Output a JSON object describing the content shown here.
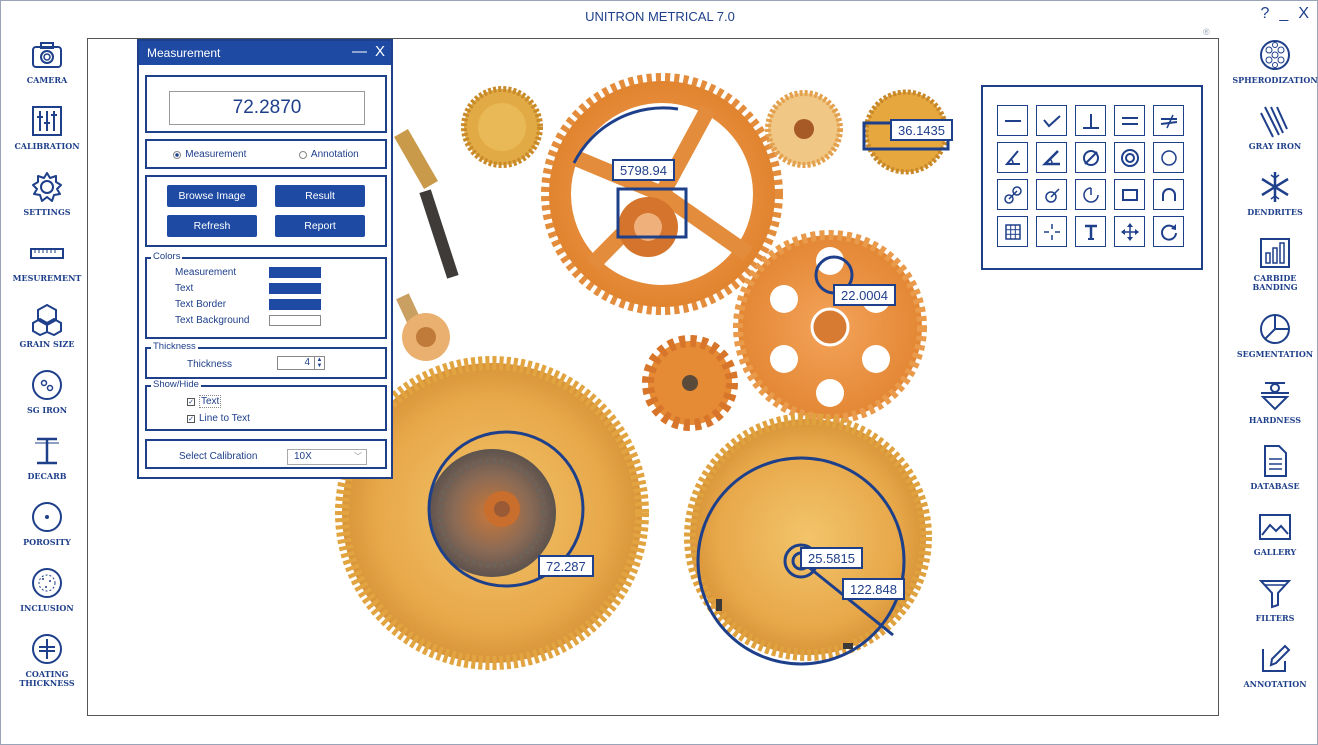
{
  "app": {
    "title": "UNITRON METRICAL 7.0",
    "help": "?",
    "minimize": "_",
    "close": "X",
    "info": "®"
  },
  "left_tools": [
    {
      "label": "CAMERA",
      "icon": "camera-icon"
    },
    {
      "label": "CALIBRATION",
      "icon": "sliders-icon"
    },
    {
      "label": "SETTINGS",
      "icon": "gear-icon"
    },
    {
      "label": "MESUREMENT",
      "icon": "ruler-icon"
    },
    {
      "label": "GRAIN SIZE",
      "icon": "grain-icon"
    },
    {
      "label": "SG IRON",
      "icon": "sg-iron-icon"
    },
    {
      "label": "DECARB",
      "icon": "decarb-icon"
    },
    {
      "label": "POROSITY",
      "icon": "porosity-icon"
    },
    {
      "label": "INCLUSION",
      "icon": "inclusion-icon"
    },
    {
      "label": "COATING",
      "label2": "THICKNESS",
      "icon": "coating-icon"
    }
  ],
  "right_tools": [
    {
      "label": "SPHERODIZATION",
      "icon": "spherodization-icon"
    },
    {
      "label": "GRAY IRON",
      "icon": "gray-iron-icon"
    },
    {
      "label": "DENDRITES",
      "icon": "snowflake-icon"
    },
    {
      "label": "CARBIDE",
      "label2": "BANDING",
      "icon": "bar-chart-icon"
    },
    {
      "label": "SEGMENTATION",
      "icon": "pie-chart-icon"
    },
    {
      "label": "HARDNESS",
      "icon": "hardness-icon"
    },
    {
      "label": "DATABASE",
      "icon": "document-icon"
    },
    {
      "label": "GALLERY",
      "icon": "gallery-icon"
    },
    {
      "label": "FILTERS",
      "icon": "funnel-icon"
    },
    {
      "label": "ANNOTATION",
      "icon": "pencil-icon"
    }
  ],
  "panel": {
    "title": "Measurement",
    "minimize": "—",
    "close": "X",
    "readout": "72.2870",
    "mode_measurement": "Measurement",
    "mode_annotation": "Annotation",
    "browse": "Browse Image",
    "result": "Result",
    "refresh": "Refresh",
    "report": "Report",
    "colors_legend": "Colors",
    "color_measurement": "Measurement",
    "color_text": "Text",
    "color_text_border": "Text Border",
    "color_text_background": "Text Background",
    "colors": {
      "measurement": "#1e4aa3",
      "text": "#1e4aa3",
      "text_border": "#1e4aa3",
      "text_background": "#ffffff"
    },
    "thickness_legend": "Thickness",
    "thickness_label": "Thickness",
    "thickness_value": "4",
    "showhide_legend": "Show/Hide",
    "show_text": "Text",
    "show_line": "Line to Text",
    "calib_label": "Select Calibration",
    "calib_value": "10X"
  },
  "measurements": {
    "m1": "5798.94",
    "m2": "36.1435",
    "m3": "22.0004",
    "m4": "72.287",
    "m5": "25.5815",
    "m6": "122.848"
  },
  "palette": [
    "line-icon",
    "polyline-icon",
    "perpendicular-icon",
    "parallel-icon",
    "not-parallel-icon",
    "angle-icon",
    "angle-three-point-icon",
    "diameter-icon",
    "concentric-circle-icon",
    "circle-icon",
    "circle-distance-icon",
    "circle-point-icon",
    "arc-icon",
    "rectangle-icon",
    "curve-icon",
    "grid-icon",
    "crosshair-icon",
    "text-tool-icon",
    "move-icon",
    "rotate-icon"
  ]
}
